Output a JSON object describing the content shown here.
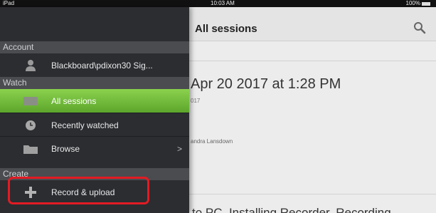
{
  "status": {
    "carrier": "iPad",
    "time": "10:03 AM",
    "battery": "100%"
  },
  "main": {
    "title": "All sessions",
    "session": {
      "title": "Apr 20 2017 at 1:28 PM",
      "date": "017",
      "owner": "andra Lansdown"
    },
    "next_title": "to PC, Installing Recorder, Recording"
  },
  "drawer": {
    "sections": {
      "account": "Account",
      "watch": "Watch",
      "create": "Create"
    },
    "account_label": "Blackboard\\pdixon30  Sig...",
    "watch_items": [
      {
        "label": "All sessions",
        "icon": "monitor-icon",
        "active": true
      },
      {
        "label": "Recently watched",
        "icon": "clock-icon",
        "active": false
      },
      {
        "label": "Browse",
        "icon": "folder-icon",
        "active": false
      }
    ],
    "record_label": "Record & upload",
    "colors": {
      "active_green": "#6cbf35",
      "drawer_bg": "#2b2d31",
      "highlight_red": "#e31b23"
    }
  }
}
